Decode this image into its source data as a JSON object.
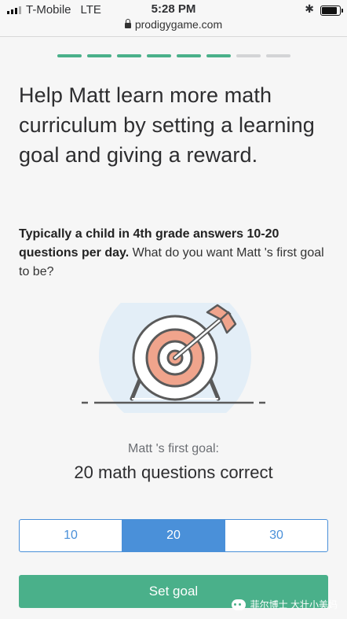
{
  "status": {
    "carrier": "T-Mobile",
    "network": "LTE",
    "time": "5:28 PM",
    "url": "prodigygame.com"
  },
  "progress": {
    "completed_steps": 6,
    "total_steps": 8,
    "colors": {
      "done": "#4ab08a",
      "pending": "#d3d4d6"
    }
  },
  "heading": "Help Matt learn more math curriculum by setting a learning goal and giving a reward.",
  "intro": {
    "bold": "Typically a child in 4th grade answers 10-20 questions per day.",
    "rest": " What do you want Matt 's first goal to be?"
  },
  "illustration": {
    "icon": "target-with-arrow-icon"
  },
  "goal": {
    "label": "Matt 's first goal:",
    "value": "20 math questions correct"
  },
  "options": [
    {
      "label": "10",
      "selected": false
    },
    {
      "label": "20",
      "selected": true
    },
    {
      "label": "30",
      "selected": false
    }
  ],
  "cta": {
    "label": "Set goal"
  },
  "watermark": {
    "text": "菲尔博士 大壮小美妈"
  },
  "colors": {
    "accent_blue": "#4a90d9",
    "accent_green": "#4ab08a",
    "target_salmon": "#f0a48c"
  }
}
